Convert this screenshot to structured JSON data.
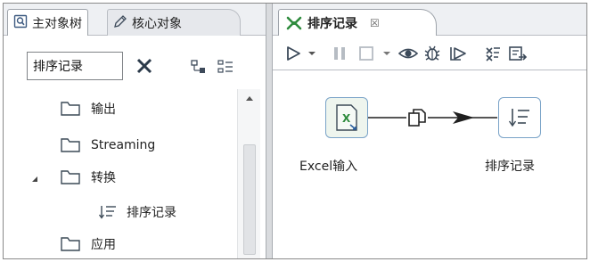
{
  "left_panel": {
    "tabs": [
      {
        "label": "主对象树",
        "icon": "search-icon",
        "active": true
      },
      {
        "label": "核心对象",
        "icon": "pencil-icon",
        "active": false
      }
    ],
    "search": {
      "value": "排序记录"
    },
    "tree": [
      {
        "label": "输出",
        "icon": "folder-icon"
      },
      {
        "label": "Streaming",
        "icon": "folder-icon"
      },
      {
        "label": "转换",
        "icon": "folder-icon",
        "expanded": true
      },
      {
        "label": "排序记录",
        "icon": "sort-icon"
      },
      {
        "label": "应用",
        "icon": "folder-icon"
      }
    ]
  },
  "right_panel": {
    "tab": {
      "label": "排序记录",
      "icon": "transformation-icon",
      "close": "☒"
    },
    "toolbar": [
      "run-icon",
      "dropdown-icon",
      "pause-icon",
      "stop-icon",
      "dropdown-icon",
      "preview-icon",
      "debug-icon",
      "replay-icon",
      "verify-icon",
      "sql-icon"
    ],
    "canvas": {
      "steps": [
        {
          "label": "Excel输入",
          "icon": "excel-input-icon"
        },
        {
          "label": "排序记录",
          "icon": "sort-icon"
        }
      ],
      "hop": {
        "icon": "copy-icon"
      }
    }
  },
  "colors": {
    "accent_green": "#2e8b3d",
    "step_border": "#7aa3c8",
    "folder": "#3c4a57"
  }
}
